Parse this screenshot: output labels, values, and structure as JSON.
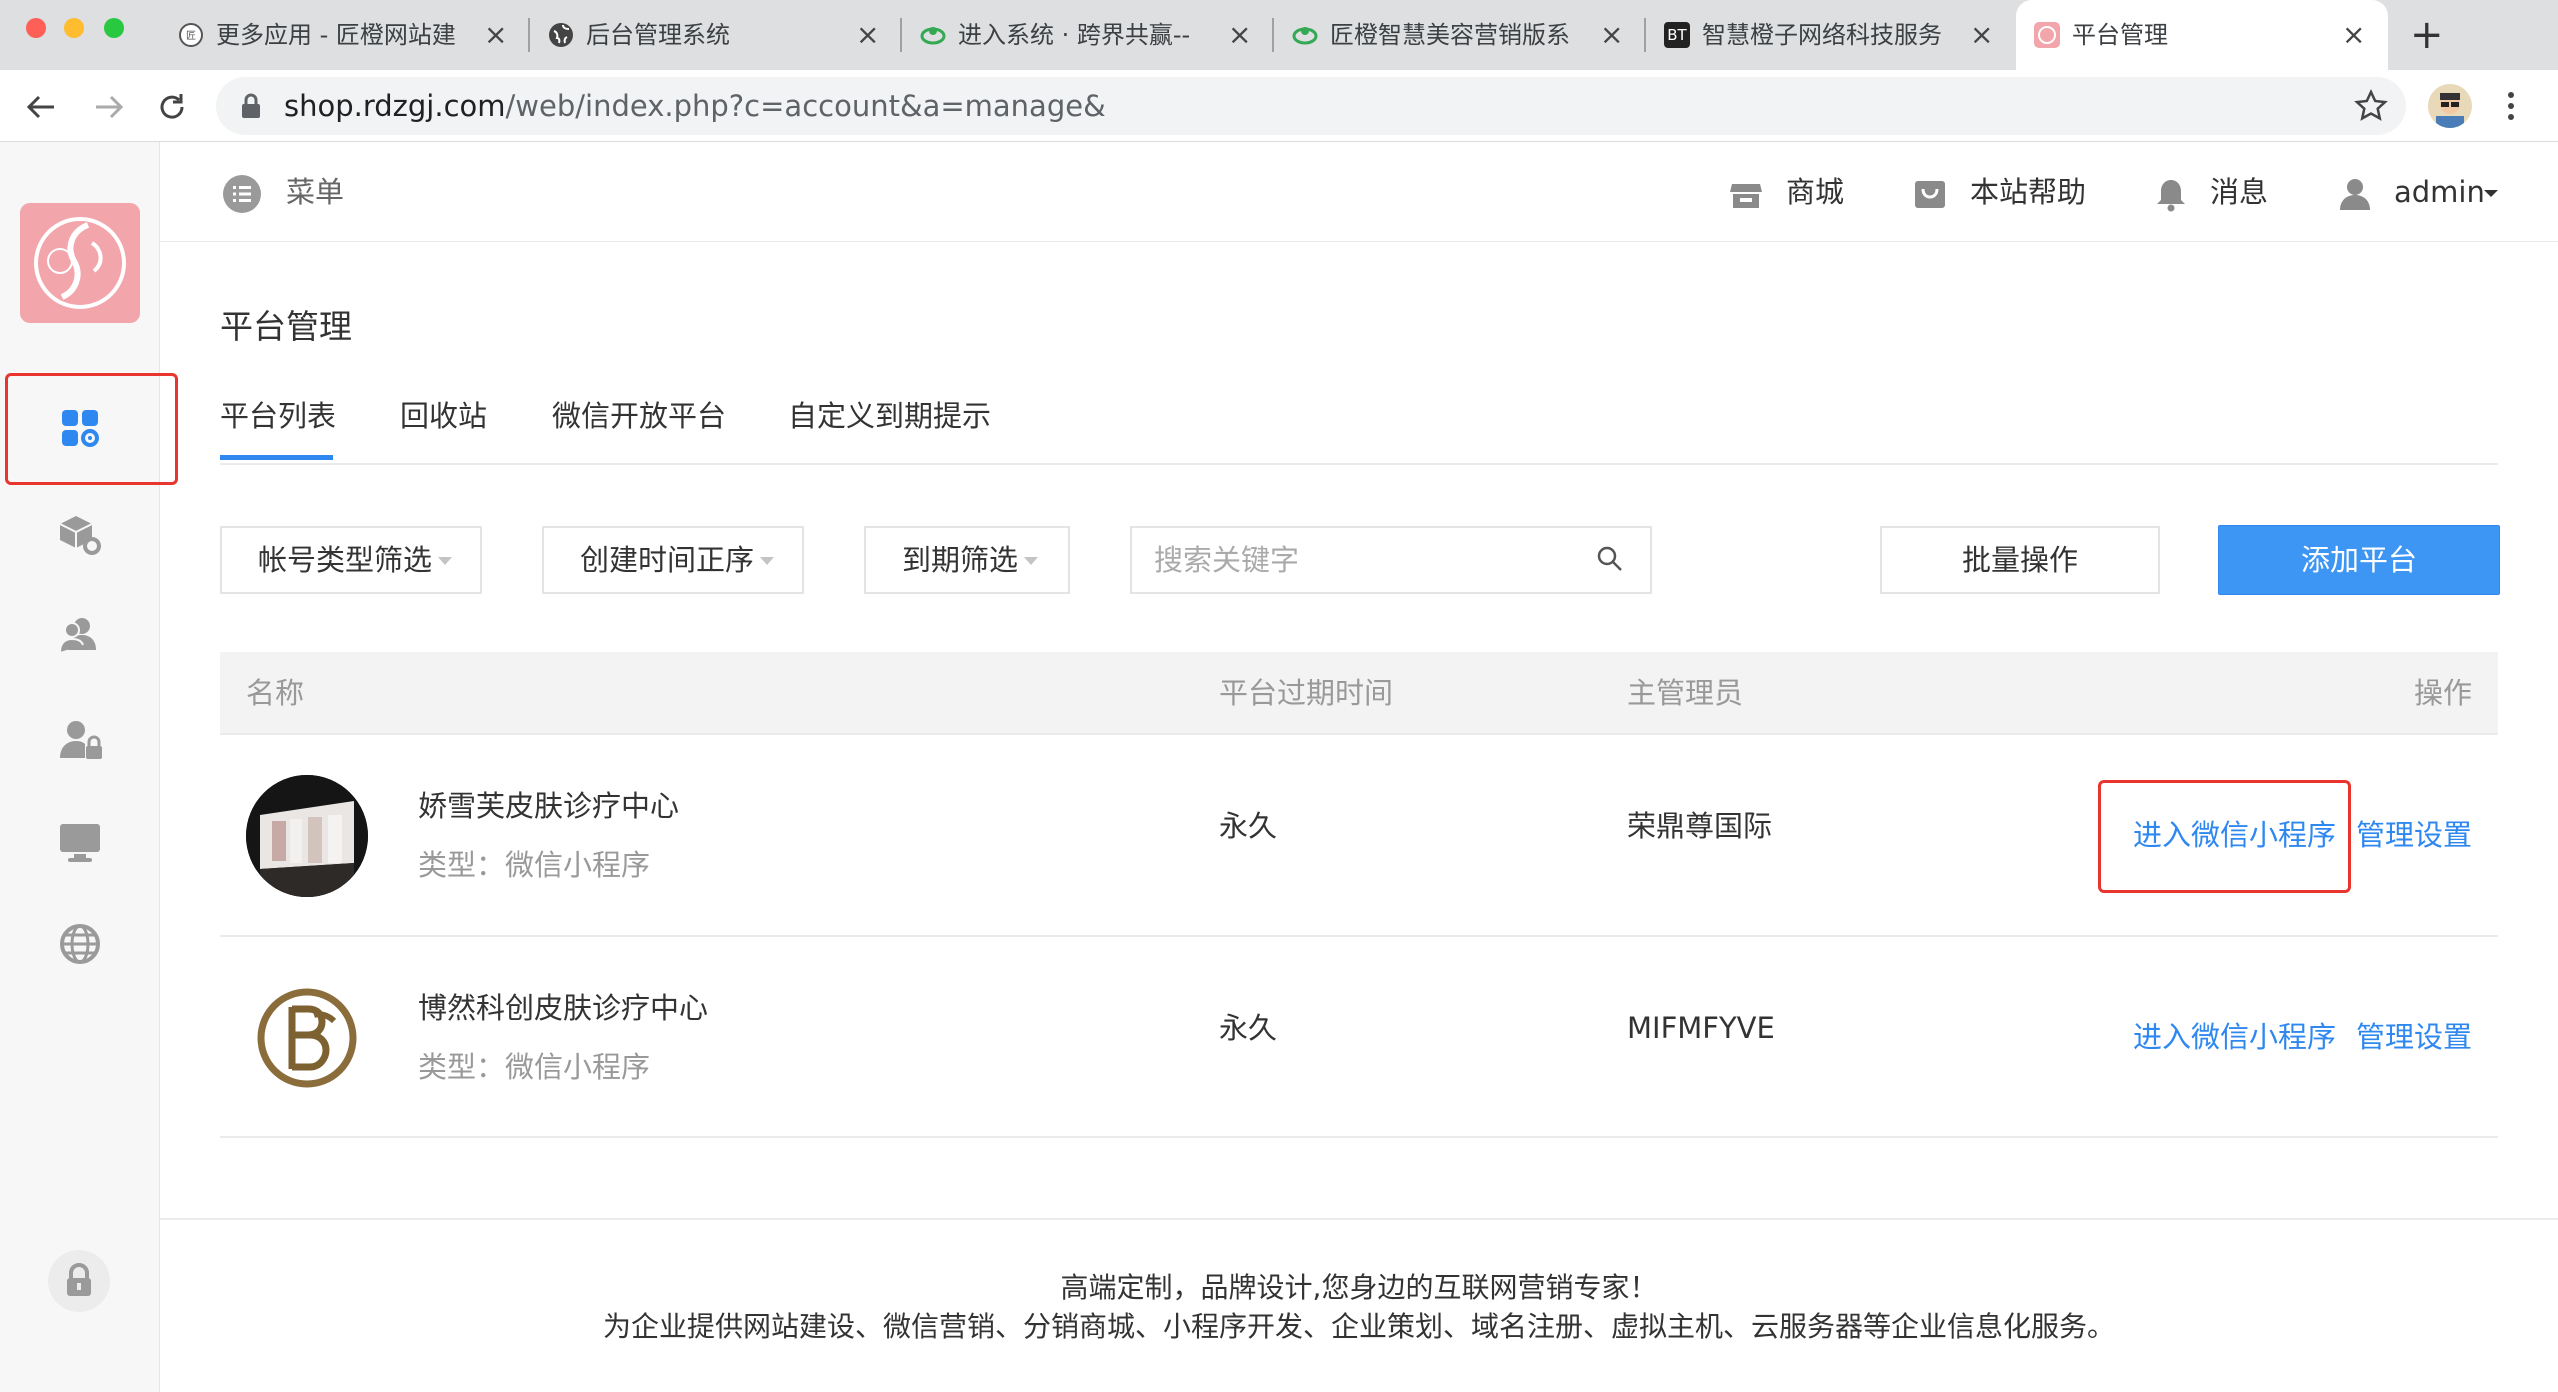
{
  "browser": {
    "tabs": [
      {
        "title": "更多应用 - 匠橙网站建"
      },
      {
        "title": "后台管理系统"
      },
      {
        "title": "进入系统 · 跨界共赢--"
      },
      {
        "title": "匠橙智慧美容营销版系"
      },
      {
        "title": "智慧橙子网络科技服务"
      },
      {
        "title": "平台管理"
      }
    ],
    "bt_badge": "BT",
    "new_tab": "+",
    "close": "×",
    "url_host": "shop.rdzgj.com",
    "url_path": "/web/index.php?c=account&a=manage&"
  },
  "topbar": {
    "menu_label": "菜单",
    "shop_label": "商城",
    "help_label": "本站帮助",
    "message_label": "消息",
    "user_label": "admin"
  },
  "page": {
    "title": "平台管理",
    "tabs": [
      "平台列表",
      "回收站",
      "微信开放平台",
      "自定义到期提示"
    ]
  },
  "filters": {
    "account_type": "帐号类型筛选",
    "create_time": "创建时间正序",
    "expire": "到期筛选",
    "search_placeholder": "搜索关键字",
    "batch": "批量操作",
    "add": "添加平台"
  },
  "table": {
    "headers": {
      "name": "名称",
      "expire": "平台过期时间",
      "admin": "主管理员",
      "actions": "操作"
    },
    "rows": [
      {
        "name": "娇雪芙皮肤诊疗中心",
        "type": "类型：微信小程序",
        "expire": "永久",
        "admin": "荣鼎尊国际",
        "enter": "进入微信小程序",
        "manage": "管理设置"
      },
      {
        "name": "博然科创皮肤诊疗中心",
        "type": "类型：微信小程序",
        "expire": "永久",
        "admin": "MIFMFYVE",
        "enter": "进入微信小程序",
        "manage": "管理设置"
      }
    ]
  },
  "footer": {
    "line1": "高端定制，品牌设计,您身边的互联网营销专家！",
    "line2": "为企业提供网站建设、微信营销、分销商城、小程序开发、企业策划、域名注册、虚拟主机、云服务器等企业信息化服务。"
  },
  "colors": {
    "accent": "#2f88f0",
    "highlight": "#e8362f",
    "logo_bg": "#f2a5aa"
  }
}
